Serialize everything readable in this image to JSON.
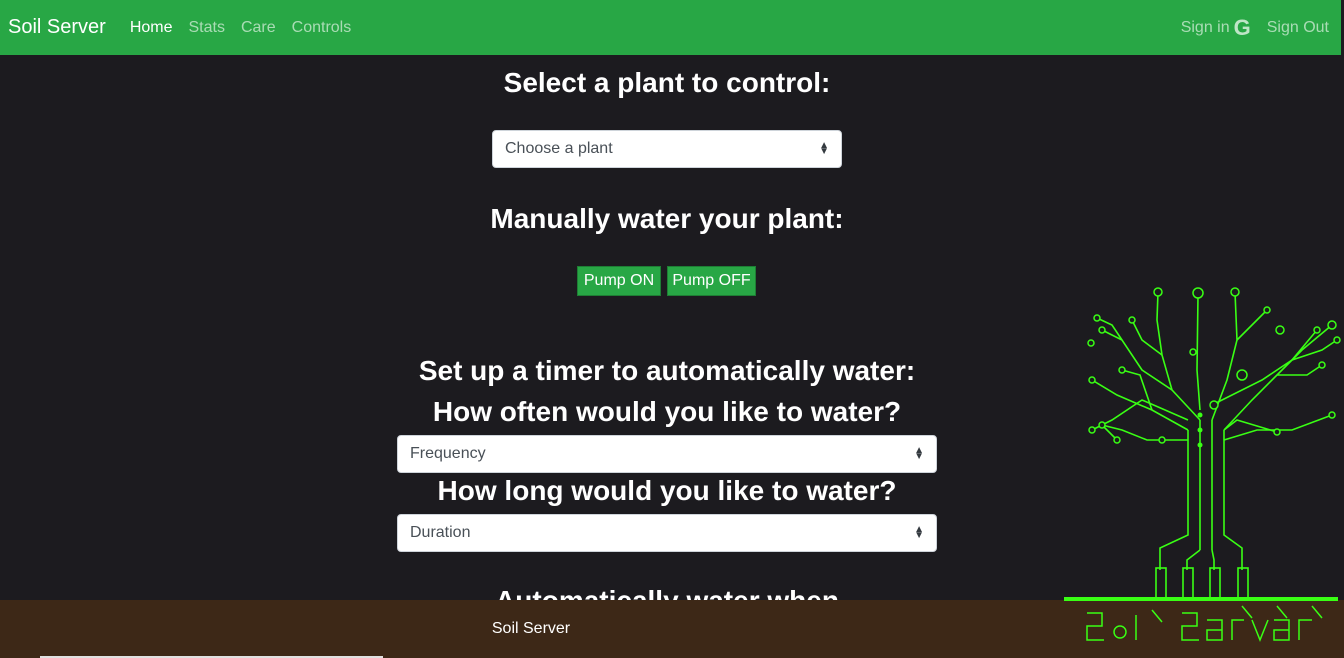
{
  "nav": {
    "brand": "Soil Server",
    "links": [
      "Home",
      "Stats",
      "Care",
      "Controls"
    ],
    "sign_in": "Sign in",
    "sign_in_icon": "G",
    "sign_out": "Sign Out"
  },
  "main": {
    "select_heading": "Select a plant to control:",
    "plant_select": "Choose a plant",
    "water_heading": "Manually water your plant:",
    "pump_on": "Pump ON",
    "pump_off": "Pump OFF",
    "timer_heading": "Set up a timer to automatically water:",
    "frequency_heading": "How often would you like to water?",
    "frequency_select": "Frequency",
    "duration_heading": "How long would you like to water?",
    "duration_select": "Duration",
    "auto_heading": "Automatically water when"
  },
  "footer": {
    "text": "Soil Server"
  },
  "colors": {
    "nav": "#28a745",
    "background": "#1c1b1f",
    "footer": "#3d2817",
    "tree": "#39ff14"
  }
}
